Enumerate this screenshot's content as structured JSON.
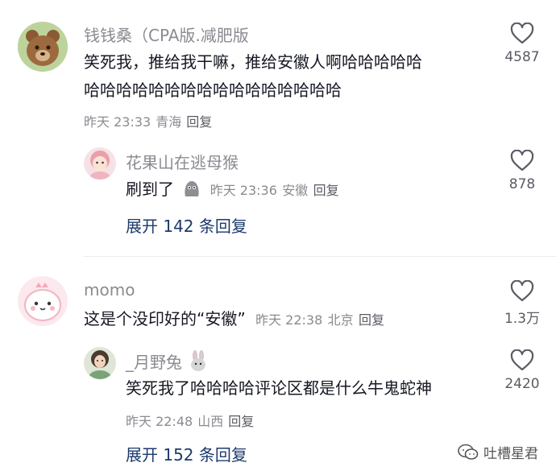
{
  "comments": [
    {
      "username": "钱钱桑（CPA版.减肥版",
      "text_line1": "笑死我，推给我干嘛，推给安徽人啊哈哈哈哈哈",
      "text_line2": "哈哈哈哈哈哈哈哈哈哈哈哈哈哈哈哈",
      "time": "昨天 23:33",
      "location": "青海",
      "reply_label": "回复",
      "likes": "4587",
      "avatar_icon": "bear-avatar",
      "reply": {
        "username": "花果山在逃母猴",
        "text": "刷到了",
        "emoji_icon": "gray-blob-emoji",
        "time": "昨天 23:36",
        "location": "安徽",
        "reply_label": "回复",
        "likes": "878"
      },
      "expand_label": "展开 142 条回复"
    },
    {
      "username": "momo",
      "text": "这是个没印好的“安徽”",
      "time": "昨天 22:38",
      "location": "北京",
      "reply_label": "回复",
      "likes": "1.3万",
      "avatar_icon": "pink-dino-avatar",
      "reply": {
        "username": "_月野兔",
        "username_emoji": "rabbit-emoji",
        "text": "笑死我了哈哈哈哈评论区都是什么牛鬼蛇神",
        "time": "昨天 22:48",
        "location": "山西",
        "reply_label": "回复",
        "likes": "2420"
      },
      "expand_label": "展开 152 条回复"
    }
  ],
  "watermark": {
    "text": "吐槽星君",
    "icon": "wechat-icon"
  },
  "colors": {
    "text": "#161823",
    "muted": "#8a8b91",
    "link": "#1d3a6b"
  }
}
